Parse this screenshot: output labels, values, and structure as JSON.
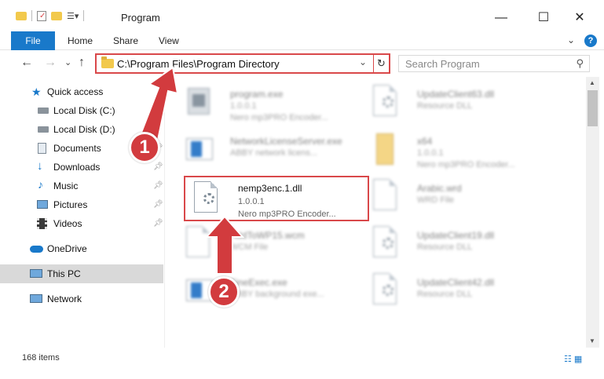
{
  "window": {
    "title": "Program",
    "minimize": "—",
    "maximize": "☐",
    "close": "✕"
  },
  "ribbon": {
    "file": "File",
    "tabs": [
      "Home",
      "Share",
      "View"
    ],
    "help": "?"
  },
  "nav": {
    "back": "←",
    "forward": "→",
    "recent": "⌄",
    "up": "↑",
    "address": "C:\\Program Files\\Program Directory",
    "search_placeholder": "Search Program"
  },
  "sidebar": {
    "items": [
      {
        "label": "Quick access",
        "icon": "star-icon"
      },
      {
        "label": "Local Disk (C:)",
        "icon": "drive-icon",
        "pinned": true
      },
      {
        "label": "Local Disk (D:)",
        "icon": "drive-icon",
        "pinned": true
      },
      {
        "label": "Documents",
        "icon": "documents-icon",
        "pinned": true
      },
      {
        "label": "Downloads",
        "icon": "download-icon",
        "pinned": true
      },
      {
        "label": "Music",
        "icon": "music-icon",
        "pinned": true
      },
      {
        "label": "Pictures",
        "icon": "pictures-icon",
        "pinned": true
      },
      {
        "label": "Videos",
        "icon": "videos-icon",
        "pinned": true
      },
      {
        "label": "OneDrive",
        "icon": "cloud-icon"
      },
      {
        "label": "This PC",
        "icon": "computer-icon",
        "selected": true
      },
      {
        "label": "Network",
        "icon": "network-icon"
      }
    ]
  },
  "files": [
    {
      "name": "program.exe",
      "line2": "1.0.0.1",
      "line3": "Nero mp3PRO Encoder...",
      "icon": "exe-icon"
    },
    {
      "name": "UpdateClient63.dll",
      "line2": "Resource DLL",
      "line3": "",
      "icon": "dll-icon"
    },
    {
      "name": "NetworkLicenseServer.exe",
      "line2": "ABBY network licens...",
      "line3": "",
      "icon": "exe-icon"
    },
    {
      "name": "x64",
      "line2": "1.0.0.1",
      "line3": "Nero mp3PRO Encoder...",
      "icon": "folder-icon"
    },
    {
      "name": "nemp3enc.1.dll",
      "line2": "1.0.0.1",
      "line3": "Nero mp3PRO Encoder...",
      "icon": "dll-icon",
      "focused": true
    },
    {
      "name": "Arabic.wrd",
      "line2": "WRD File",
      "line3": "",
      "icon": "file-icon"
    },
    {
      "name": "AddToWP15.wcm",
      "line2": "WCM File",
      "line3": "",
      "icon": "file-icon"
    },
    {
      "name": "UpdateClient19.dll",
      "line2": "Resource DLL",
      "line3": "",
      "icon": "dll-icon"
    },
    {
      "name": "FineExec.exe",
      "line2": "ABBY background exe...",
      "line3": "",
      "icon": "exe-icon"
    },
    {
      "name": "UpdateClient42.dll",
      "line2": "Resource DLL",
      "line3": "",
      "icon": "dll-icon"
    }
  ],
  "status": {
    "count": "168 items"
  },
  "annotations": {
    "one": "1",
    "two": "2"
  },
  "colors": {
    "accent": "#1979ca",
    "highlight": "#d9484a"
  }
}
